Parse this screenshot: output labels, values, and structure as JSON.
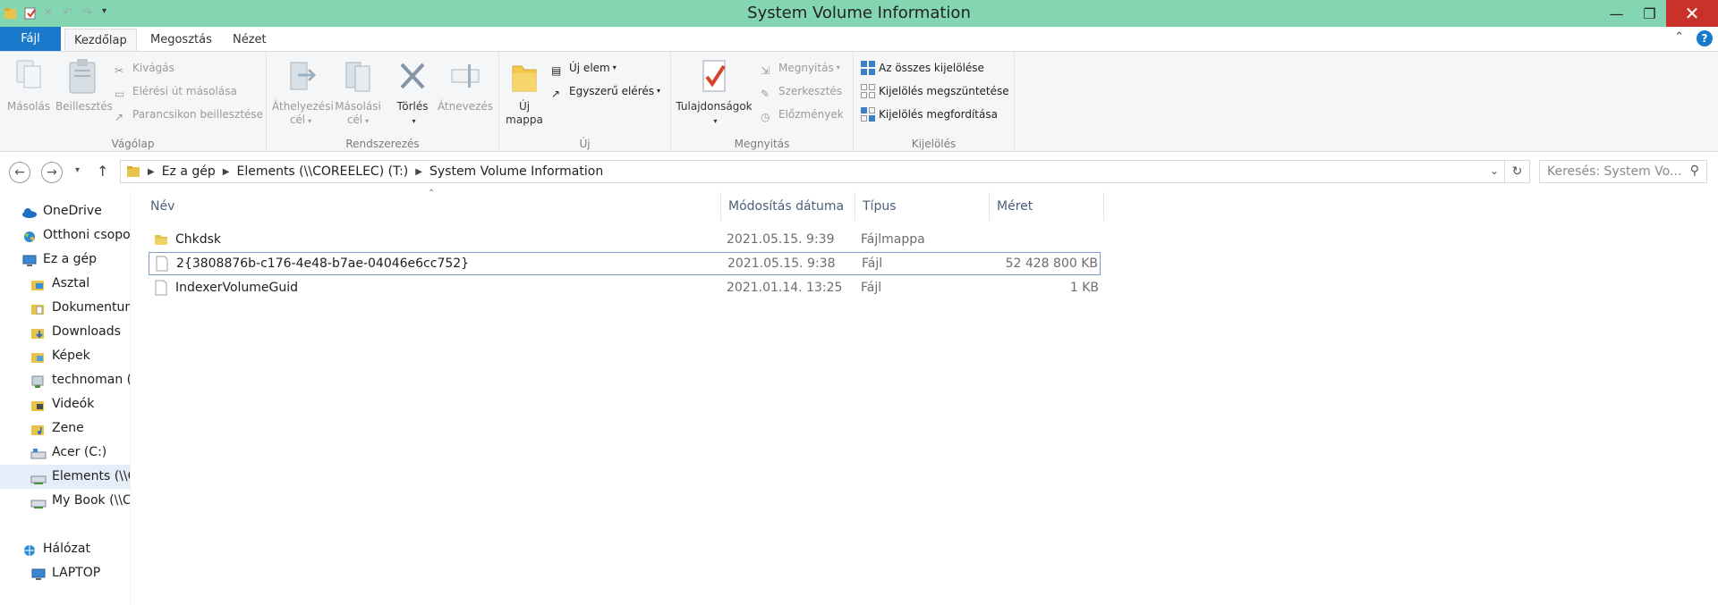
{
  "window": {
    "title": "System Volume Information"
  },
  "tabs": {
    "file": "Fájl",
    "home": "Kezdőlap",
    "share": "Megosztás",
    "view": "Nézet"
  },
  "ribbon": {
    "clipboard": {
      "label": "Vágólap",
      "copy": "Másolás",
      "paste": "Beillesztés",
      "cut": "Kivágás",
      "copy_path": "Elérési út másolása",
      "paste_shortcut": "Parancsikon beillesztése"
    },
    "organize": {
      "label": "Rendszerezés",
      "move_to": [
        "Áthelyezési",
        "cél"
      ],
      "copy_to": [
        "Másolási",
        "cél"
      ],
      "delete": "Törlés",
      "rename": "Átnevezés"
    },
    "new": {
      "label": "Új",
      "new_folder": [
        "Új",
        "mappa"
      ],
      "new_item": "Új elem",
      "easy_access": "Egyszerű elérés"
    },
    "open": {
      "label": "Megnyitás",
      "properties": "Tulajdonságok",
      "open": "Megnyitás",
      "edit": "Szerkesztés",
      "history": "Előzmények"
    },
    "select": {
      "label": "Kijelölés",
      "select_all": "Az összes kijelölése",
      "select_none": "Kijelölés megszüntetése",
      "invert": "Kijelölés megfordítása"
    }
  },
  "address": {
    "path": [
      "Ez a gép",
      "Elements (\\\\COREELEC) (T:)",
      "System Volume Information"
    ],
    "search_placeholder": "Keresés: System Vo..."
  },
  "nav": [
    {
      "label": "OneDrive",
      "icon": "cloud-icon"
    },
    {
      "label": "Otthoni csopo",
      "icon": "homegroup-icon"
    },
    {
      "label": "Ez a gép",
      "icon": "computer-icon"
    },
    {
      "label": "Asztal",
      "icon": "desktop-folder-icon"
    },
    {
      "label": "Dokumentum",
      "icon": "documents-folder-icon"
    },
    {
      "label": "Downloads",
      "icon": "downloads-folder-icon"
    },
    {
      "label": "Képek",
      "icon": "pictures-folder-icon"
    },
    {
      "label": "technoman (",
      "icon": "network-drive-icon"
    },
    {
      "label": "Videók",
      "icon": "videos-folder-icon"
    },
    {
      "label": "Zene",
      "icon": "music-folder-icon"
    },
    {
      "label": "Acer (C:)",
      "icon": "drive-icon"
    },
    {
      "label": "Elements (\\\\C",
      "icon": "network-drive-icon"
    },
    {
      "label": "My Book (\\\\C",
      "icon": "network-drive-icon"
    },
    {
      "label": "Hálózat",
      "icon": "network-icon"
    },
    {
      "label": "LAPTOP",
      "icon": "computer-icon"
    }
  ],
  "columns": {
    "name": "Név",
    "date": "Módosítás dátuma",
    "type": "Típus",
    "size": "Méret"
  },
  "files": [
    {
      "name": "Chkdsk",
      "date": "2021.05.15. 9:39",
      "type": "Fájlmappa",
      "size": "",
      "icon": "folder-icon"
    },
    {
      "name": "2{3808876b-c176-4e48-b7ae-04046e6cc752}",
      "date": "2021.05.15. 9:38",
      "type": "Fájl",
      "size": "52 428 800 KB",
      "icon": "file-icon"
    },
    {
      "name": "IndexerVolumeGuid",
      "date": "2021.01.14. 13:25",
      "type": "Fájl",
      "size": "1 KB",
      "icon": "file-icon"
    }
  ]
}
